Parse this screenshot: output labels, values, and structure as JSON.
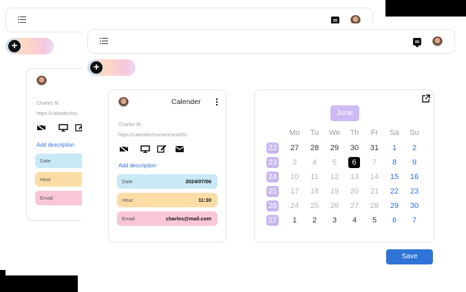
{
  "back": {
    "name": "Charles M.",
    "url": "https://calender/reu",
    "add_description": "Add description",
    "fields": [
      "Date",
      "Hour",
      "Email"
    ]
  },
  "front": {
    "card_title": "Calender",
    "name": "Charles M.",
    "url": "https://calender/reunion/next001",
    "add_description": "Add description",
    "fields": [
      {
        "label": "Date",
        "value": "2024/07/06",
        "color": "#c9e9f7"
      },
      {
        "label": "Hour",
        "value": "11:30",
        "color": "#fcdca6"
      },
      {
        "label": "Email",
        "value": "charles@mail.com",
        "color": "#f9c6d8"
      }
    ]
  },
  "calendar": {
    "month": "June",
    "weekdays": [
      "Mo",
      "Tu",
      "We",
      "Th",
      "Fr",
      "Sa",
      "Su"
    ],
    "weeks": [
      {
        "num": "22",
        "days": [
          "27",
          "28",
          "29",
          "30",
          "31",
          "1",
          "2"
        ]
      },
      {
        "num": "23",
        "days": [
          "3",
          "4",
          "5",
          "6",
          "7",
          "8",
          "9"
        ]
      },
      {
        "num": "24",
        "days": [
          "10",
          "11",
          "12",
          "13",
          "14",
          "15",
          "16"
        ]
      },
      {
        "num": "25",
        "days": [
          "17",
          "18",
          "19",
          "20",
          "21",
          "22",
          "23"
        ]
      },
      {
        "num": "26",
        "days": [
          "24",
          "25",
          "26",
          "27",
          "28",
          "29",
          "30"
        ]
      },
      {
        "num": "27",
        "days": [
          "1",
          "2",
          "3",
          "4",
          "5",
          "6",
          "7"
        ]
      }
    ],
    "selected": "6",
    "save_label": "Save"
  },
  "icons": {
    "menu": "menu-icon",
    "chat": "chat-icon",
    "add": "plus-icon",
    "video_off": "video-off-icon",
    "monitor": "monitor-icon",
    "edit": "edit-icon",
    "mail": "mail-icon",
    "kebab": "more-vertical-icon",
    "external": "external-link-icon"
  },
  "colors": {
    "accent": "#2f74d6",
    "week_badge": "#c9b6ef",
    "month_badge": "#cdbaf3"
  }
}
